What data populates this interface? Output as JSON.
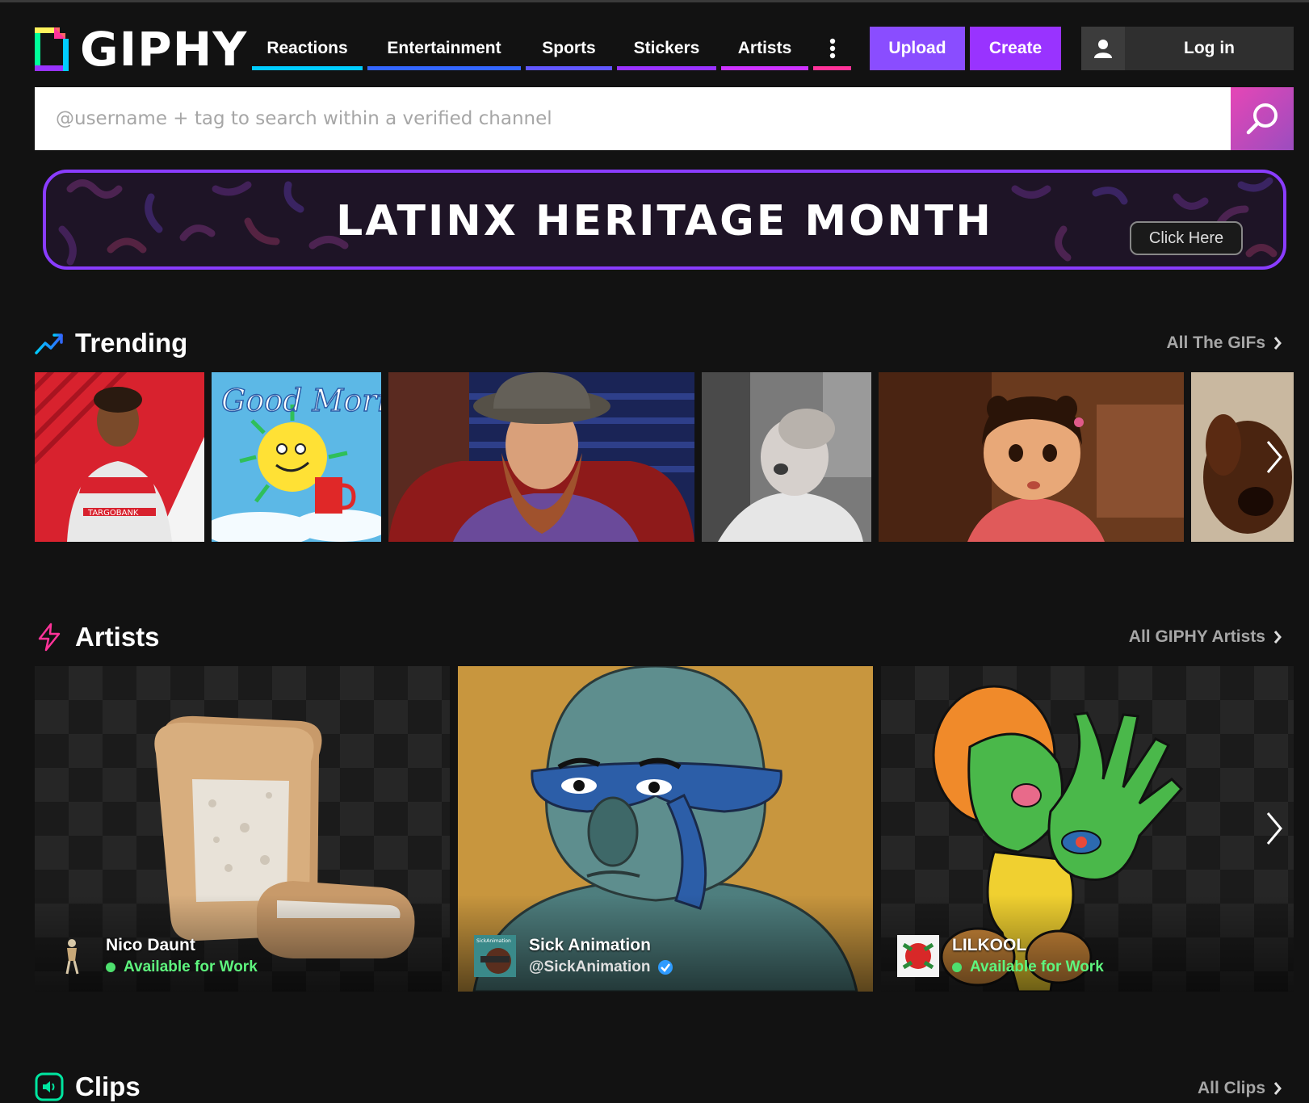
{
  "brand": {
    "name": "GIPHY"
  },
  "nav": {
    "items": [
      {
        "label": "Reactions",
        "color": "#00ccff"
      },
      {
        "label": "Entertainment",
        "color": "#3366ff"
      },
      {
        "label": "Sports",
        "color": "#6157ff"
      },
      {
        "label": "Stickers",
        "color": "#9933ff"
      },
      {
        "label": "Artists",
        "color": "#cc33ff"
      }
    ],
    "more_icon": "more-vertical-icon",
    "more_color": "#ff3399",
    "upload_label": "Upload",
    "create_label": "Create",
    "login_label": "Log in"
  },
  "search": {
    "placeholder": "@username + tag to search within a verified channel",
    "value": ""
  },
  "banner": {
    "title": "LATINX HERITAGE MONTH",
    "cta": "Click Here"
  },
  "trending": {
    "title": "Trending",
    "link": "All The GIFs",
    "items": [
      {
        "alt": "soccer player"
      },
      {
        "alt": "good morning sun",
        "text": "Good Morning"
      },
      {
        "alt": "bearded man in hat"
      },
      {
        "alt": "laughing baby"
      },
      {
        "alt": "animated girl"
      },
      {
        "alt": "dog"
      }
    ]
  },
  "artists": {
    "title": "Artists",
    "link": "All GIPHY Artists",
    "cards": [
      {
        "name": "Nico Daunt",
        "status": "Available for Work"
      },
      {
        "name": "Sick Animation",
        "handle": "@SickAnimation",
        "avatar_text": "SickAnimation"
      },
      {
        "name": "LILKOOL",
        "status": "Available for Work"
      }
    ]
  },
  "clips": {
    "title": "Clips",
    "link": "All Clips"
  },
  "colors": {
    "background": "#121212",
    "upload": "#8a4dff",
    "create": "#9933ff",
    "search_button": "#e646b6",
    "available": "#5ef57e"
  }
}
